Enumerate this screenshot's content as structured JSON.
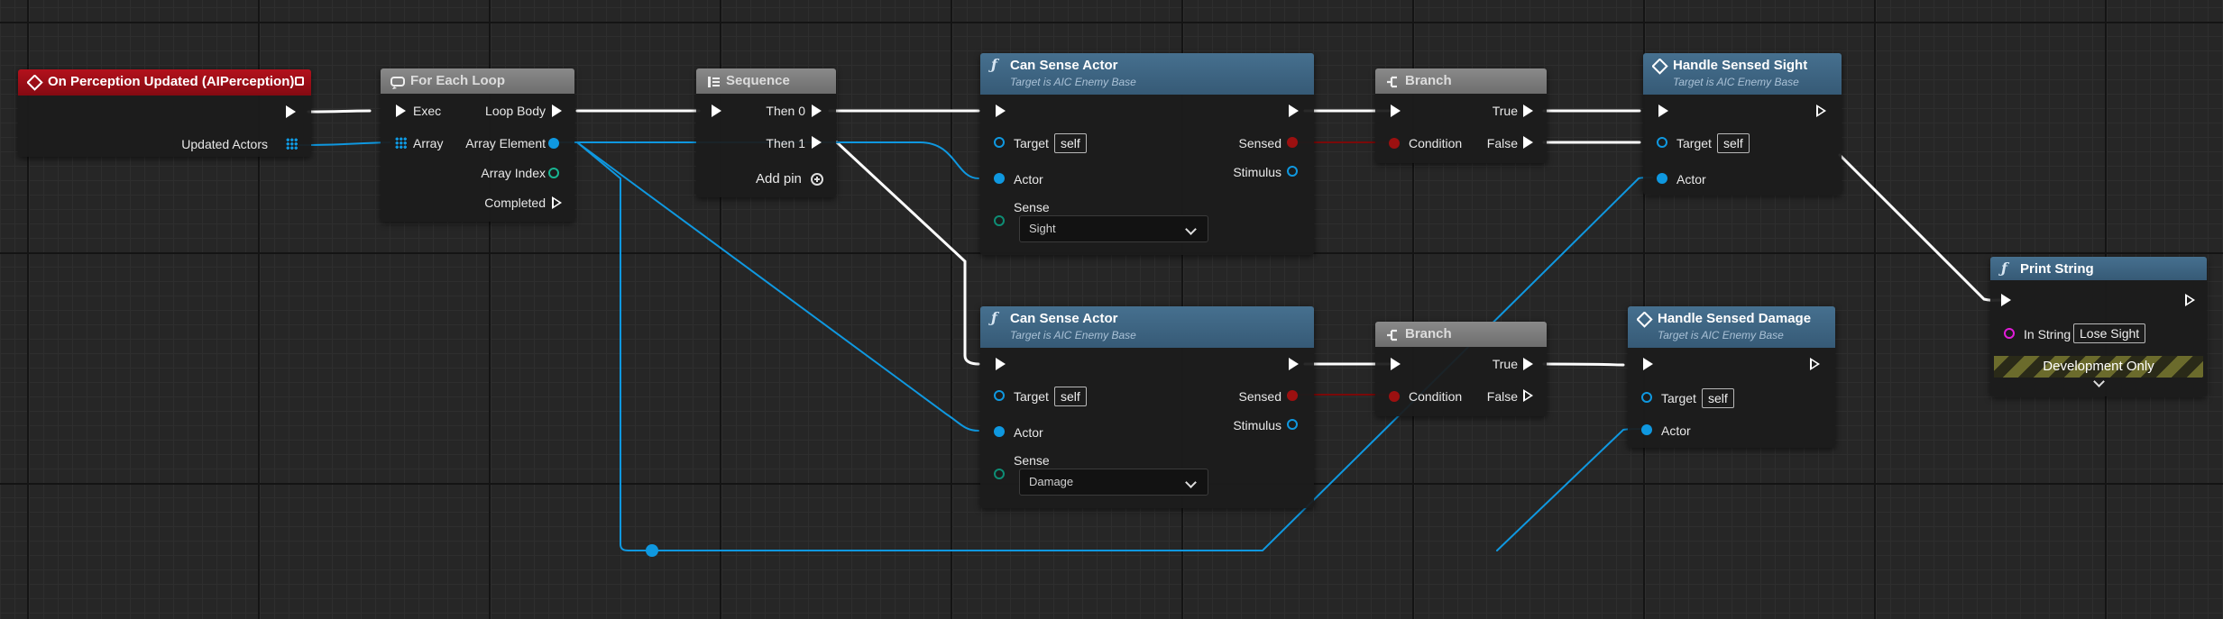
{
  "colors": {
    "exec_wire": "#ffffff",
    "object_wire": "#0f98e0",
    "bool_wire": "#8c0b0b",
    "event_header": "#b3111c",
    "function_header": "#436b8b",
    "macro_header": "#7f7f7f"
  },
  "event_node": {
    "title": "On Perception Updated (AIPerception)",
    "pin_updated_actors": "Updated Actors"
  },
  "foreach_node": {
    "title": "For Each Loop",
    "pin_exec": "Exec",
    "pin_array": "Array",
    "pin_loop_body": "Loop Body",
    "pin_array_element": "Array Element",
    "pin_array_index": "Array Index",
    "pin_completed": "Completed"
  },
  "sequence_node": {
    "title": "Sequence",
    "pin_then0": "Then 0",
    "pin_then1": "Then 1",
    "add_pin": "Add pin"
  },
  "can_sense_1": {
    "title": "Can Sense Actor",
    "subtitle": "Target is AIC Enemy Base",
    "pin_target": "Target",
    "target_value": "self",
    "pin_actor": "Actor",
    "pin_sense": "Sense",
    "sense_value": "Sight",
    "pin_sensed": "Sensed",
    "pin_stimulus": "Stimulus"
  },
  "can_sense_2": {
    "title": "Can Sense Actor",
    "subtitle": "Target is AIC Enemy Base",
    "pin_target": "Target",
    "target_value": "self",
    "pin_actor": "Actor",
    "pin_sense": "Sense",
    "sense_value": "Damage",
    "pin_sensed": "Sensed",
    "pin_stimulus": "Stimulus"
  },
  "branch_1": {
    "title": "Branch",
    "pin_condition": "Condition",
    "pin_true": "True",
    "pin_false": "False"
  },
  "branch_2": {
    "title": "Branch",
    "pin_condition": "Condition",
    "pin_true": "True",
    "pin_false": "False"
  },
  "handle_sight": {
    "title": "Handle Sensed Sight",
    "subtitle": "Target is AIC Enemy Base",
    "pin_target": "Target",
    "target_value": "self",
    "pin_actor": "Actor"
  },
  "handle_damage": {
    "title": "Handle Sensed Damage",
    "subtitle": "Target is AIC Enemy Base",
    "pin_target": "Target",
    "target_value": "self",
    "pin_actor": "Actor"
  },
  "print_node": {
    "title": "Print String",
    "pin_in_string": "In String",
    "in_string_value": "Lose Sight",
    "dev_only": "Development Only"
  },
  "icons": [
    "event-icon",
    "foreach-icon",
    "sequence-icon",
    "function-icon",
    "branch-icon",
    "custom-event-icon",
    "delegate-tag-icon"
  ]
}
